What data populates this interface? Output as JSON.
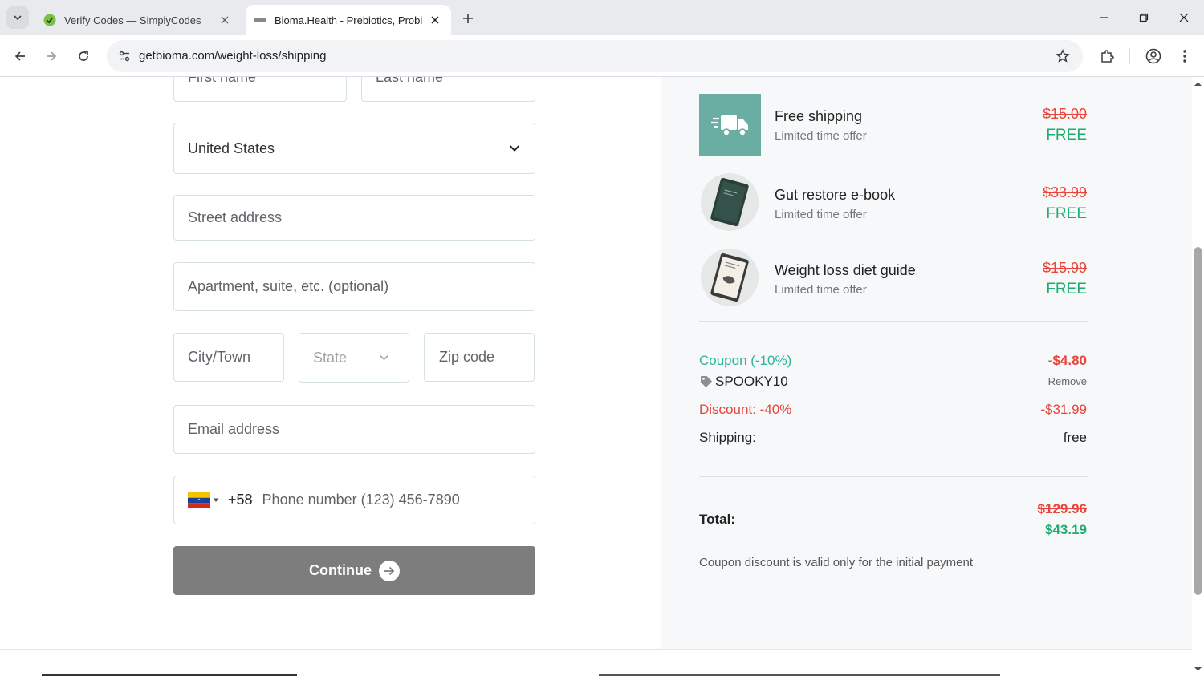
{
  "browser": {
    "tabs": [
      {
        "title": "Verify Codes — SimplyCodes",
        "active": false
      },
      {
        "title": "Bioma.Health - Prebiotics, Probi",
        "active": true
      }
    ],
    "url": "getbioma.com/weight-loss/shipping"
  },
  "form": {
    "first_name_placeholder": "First name",
    "last_name_placeholder": "Last name",
    "country_value": "United States",
    "street_placeholder": "Street address",
    "apartment_placeholder": "Apartment, suite, etc. (optional)",
    "city_placeholder": "City/Town",
    "state_placeholder": "State",
    "zip_placeholder": "Zip code",
    "email_placeholder": "Email address",
    "phone_code": "+58",
    "phone_placeholder": "Phone number (123) 456-7890",
    "continue_label": "Continue"
  },
  "summary": {
    "items": [
      {
        "name": "Free shipping",
        "sub": "Limited time offer",
        "old_price": "$15.00",
        "price": "FREE",
        "thumb": "truck-icon"
      },
      {
        "name": "Gut restore e-book",
        "sub": "Limited time offer",
        "old_price": "$33.99",
        "price": "FREE",
        "thumb": "ebook-image"
      },
      {
        "name": "Weight loss diet guide",
        "sub": "Limited time offer",
        "old_price": "$15.99",
        "price": "FREE",
        "thumb": "guide-image"
      }
    ],
    "coupon_label": "Coupon (-10%)",
    "coupon_amount": "-$4.80",
    "coupon_code": "SPOOKY10",
    "remove_label": "Remove",
    "discount_label": "Discount: -40%",
    "discount_amount": "-$31.99",
    "shipping_label": "Shipping:",
    "shipping_value": "free",
    "total_label": "Total:",
    "total_old": "$129.96",
    "total_new": "$43.19",
    "note": "Coupon discount is valid only for the initial payment"
  },
  "colors": {
    "accent_green": "#1ead6f",
    "coupon_teal": "#2bb59a",
    "red": "#e8453c",
    "thumb_teal": "#6aaea3",
    "button_gray": "#7d7d7d"
  }
}
